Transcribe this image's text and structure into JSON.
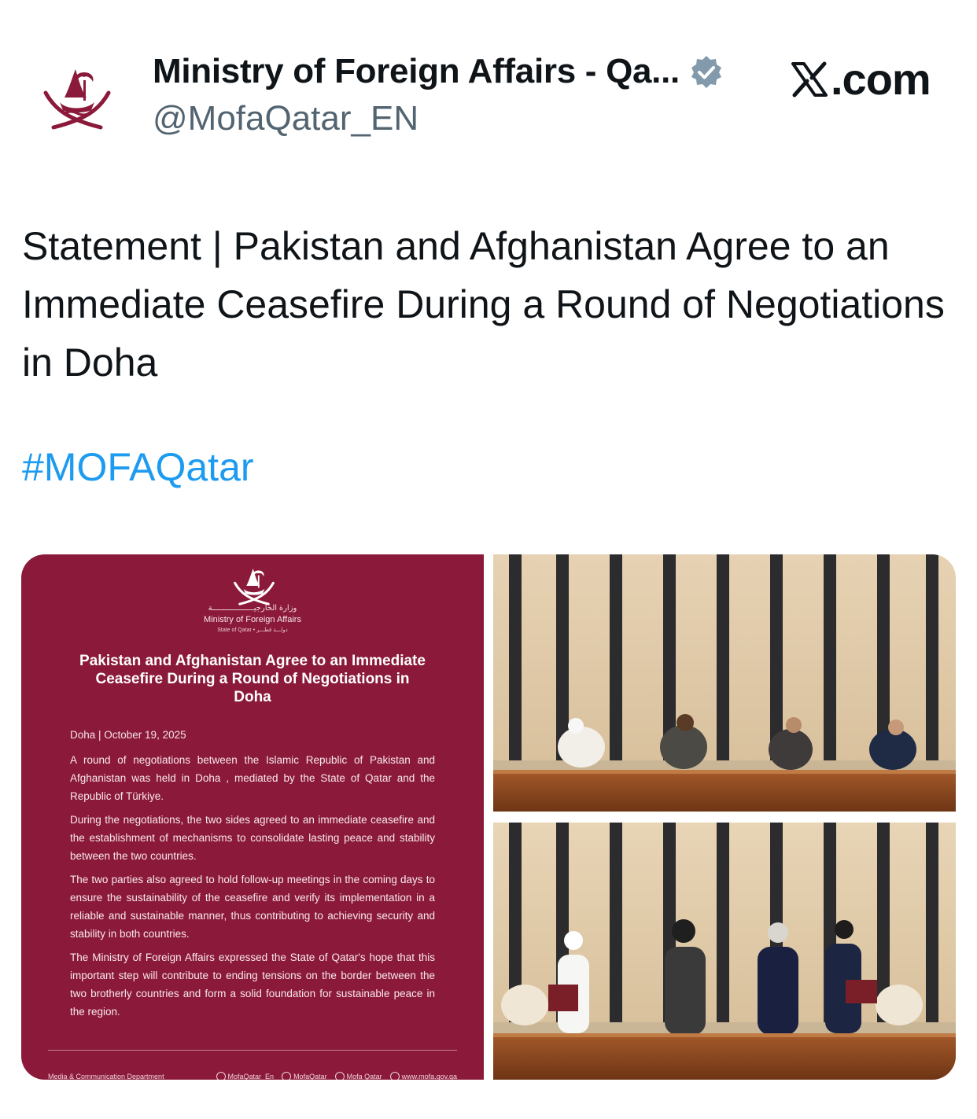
{
  "header": {
    "display_name": "Ministry of Foreign Affairs - Qa...",
    "handle": "@MofaQatar_EN",
    "site_label": ".com"
  },
  "tweet": {
    "text": "Statement | Pakistan and Afghanistan Agree to an Immediate Ceasefire During a Round of Negotiations in Doha",
    "hashtag": "#MOFAQatar"
  },
  "statement_card": {
    "ministry_ar": "وزارة الخارجيــــــــــــــــــة",
    "ministry_en": "Ministry of Foreign Affairs",
    "ministry_sub": "State of Qatar • دولـــة قطـــر",
    "title": "Pakistan and Afghanistan Agree to an Immediate Ceasefire During a Round of Negotiations in Doha",
    "dateline": "Doha | October 19, 2025",
    "paragraphs": [
      "A round of negotiations between the Islamic Republic of Pakistan and Afghanistan was held in Doha , mediated by the State of Qatar and the Republic of Türkiye.",
      "During the negotiations, the two sides agreed to an immediate ceasefire and the establishment of mechanisms to consolidate lasting peace and stability between the two countries.",
      "The two parties also agreed to hold follow-up meetings in the coming days to ensure the sustainability of the ceasefire and verify its implementation in a reliable and sustainable manner, thus contributing to achieving security and stability in both countries.",
      "The Ministry of Foreign Affairs expressed the State of Qatar's hope that this important step will contribute to ending tensions on the border between the two brotherly countries and form a solid foundation for sustainable peace in the region."
    ],
    "footer_department": "Media & Communication Department",
    "footer_links": [
      "MofaQatar_En",
      "MofaQatar",
      "Mofa Qatar",
      "www.mofa.gov.qa"
    ]
  },
  "colors": {
    "maroon": "#8b1a3a",
    "hashtag_blue": "#1d9bf0",
    "handle_gray": "#536471",
    "verified_badge": "#829aab"
  },
  "icons": [
    "qatar-emblem-icon",
    "verified-badge-icon",
    "x-logo-icon",
    "x-social-icon",
    "instagram-icon",
    "youtube-icon",
    "globe-icon"
  ]
}
